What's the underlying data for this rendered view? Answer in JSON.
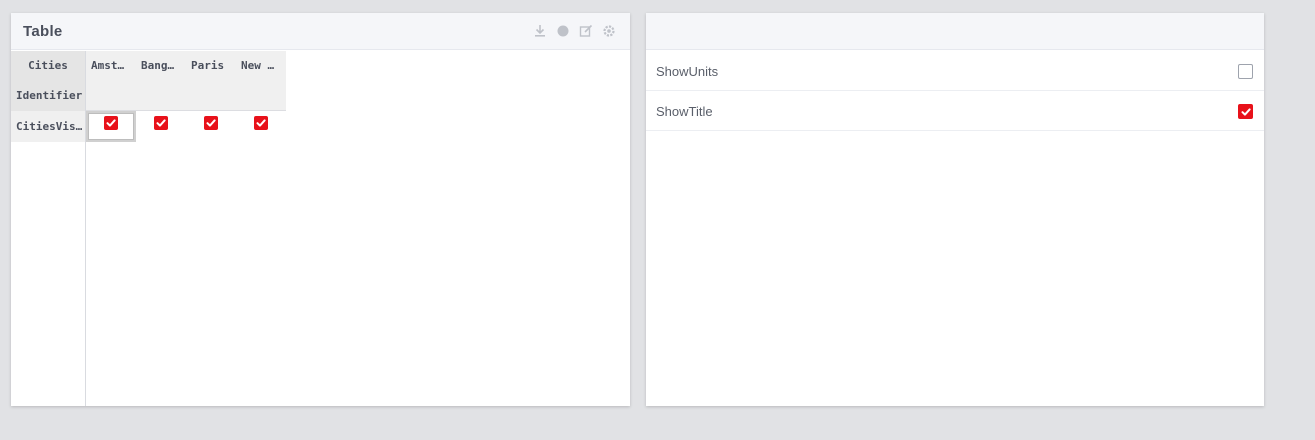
{
  "left_panel": {
    "title": "Table",
    "tools": [
      "download-icon",
      "chat-icon",
      "edit-icon",
      "settings-icon"
    ],
    "table": {
      "row_header_labels": [
        "Cities",
        "Identifier"
      ],
      "column_headers": [
        "Amst…",
        "Bang…",
        "Paris",
        "New …"
      ],
      "rows": [
        {
          "label": "CitiesVisit…",
          "values": [
            true,
            true,
            true,
            true
          ]
        }
      ],
      "selected_column_index": 0
    }
  },
  "right_panel": {
    "title": "",
    "properties": [
      {
        "label": "ShowUnits",
        "checked": false
      },
      {
        "label": "ShowTitle",
        "checked": true
      }
    ]
  },
  "colors": {
    "checkbox_checked": "#e8111a",
    "background": "#e1e2e5",
    "header_bg": "#f5f6f9"
  }
}
